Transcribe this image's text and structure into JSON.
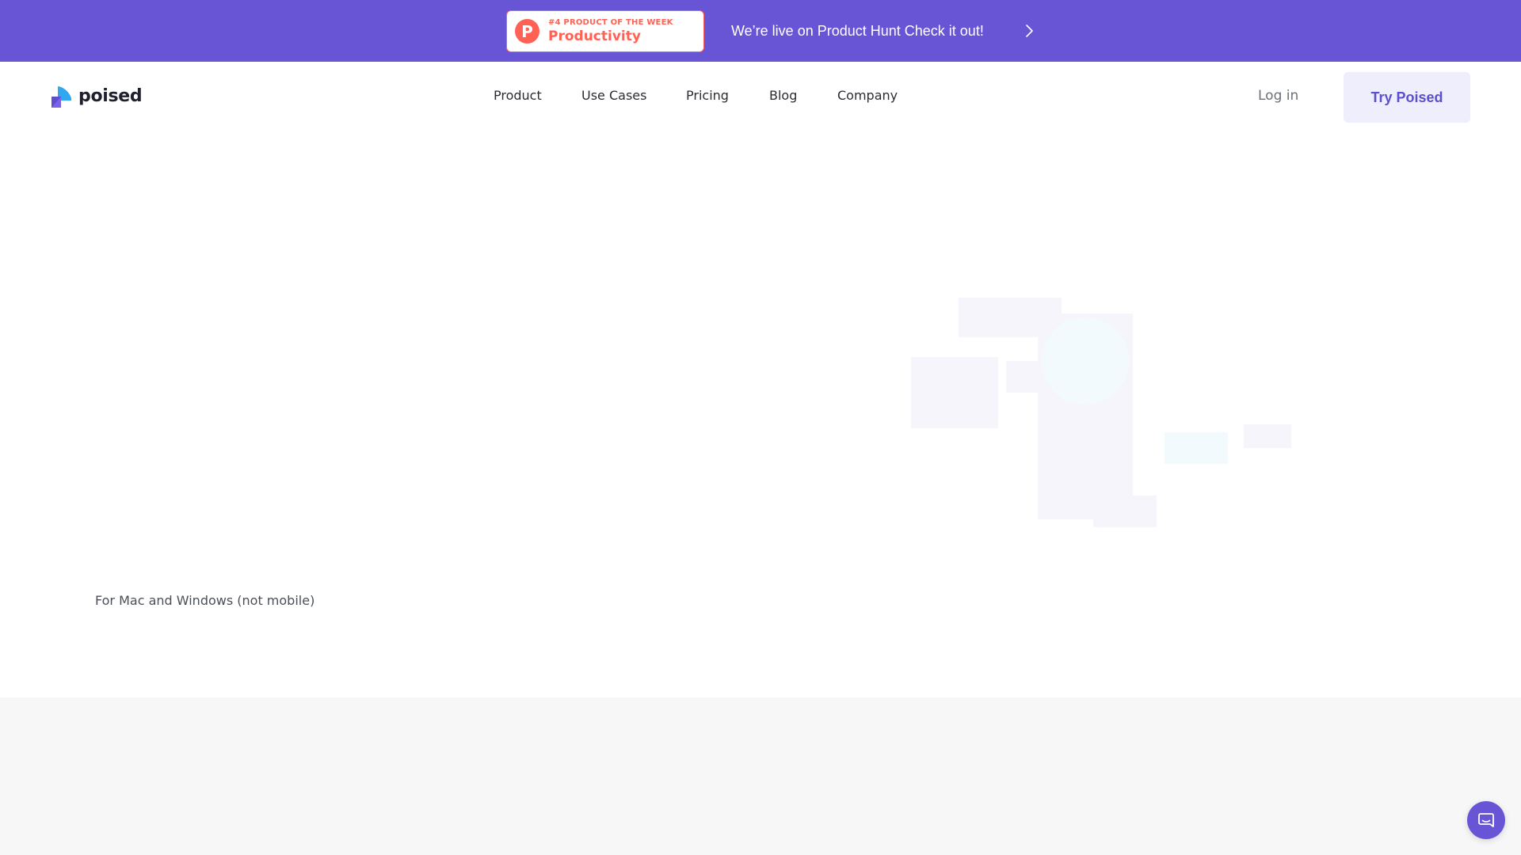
{
  "announcement": {
    "badge_kicker": "#4 PRODUCT OF THE WEEK",
    "badge_category": "Productivity",
    "badge_icon_letter": "P",
    "message": "We’re live on Product Hunt  Check it out!",
    "chevron_icon": "chevron-right-icon",
    "background_color": "#6755d6",
    "badge_color": "#ff6154"
  },
  "header": {
    "brand": "poised",
    "nav": [
      {
        "label": "Product"
      },
      {
        "label": "Use Cases"
      },
      {
        "label": "Pricing"
      },
      {
        "label": "Blog"
      },
      {
        "label": "Company"
      }
    ],
    "login_label": "Log in",
    "cta_label": "Try Poised",
    "cta_color": "#5b4fcf"
  },
  "hero": {
    "platform_note": "For Mac and Windows (not mobile)"
  },
  "chat": {
    "icon": "chat-bubble-icon"
  }
}
